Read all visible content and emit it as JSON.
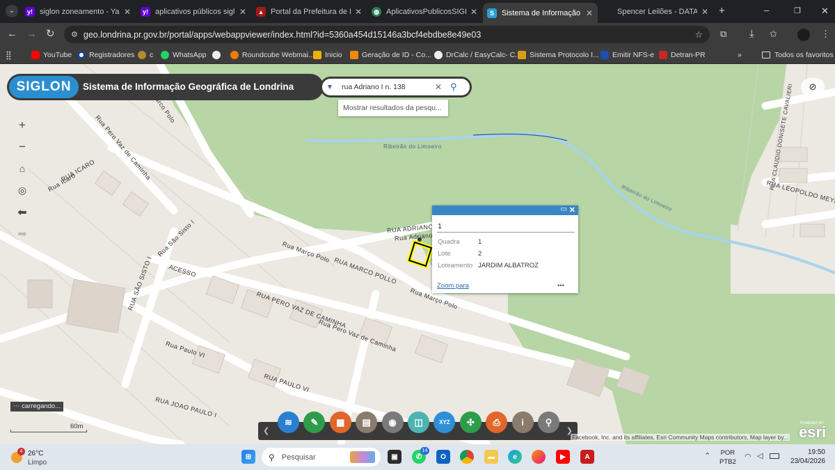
{
  "browser": {
    "tabs": [
      {
        "title": "siglon zoneamento - Yahoo",
        "fav": "yahoo-icon",
        "color": "#6001d2"
      },
      {
        "title": "aplicativos públicos siglon",
        "fav": "yahoo-icon",
        "color": "#6001d2"
      },
      {
        "title": "Portal da Prefeitura de Londrina",
        "fav": "crest-icon",
        "color": "#a11a1a"
      },
      {
        "title": "AplicativosPublicosSIGLON",
        "fav": "globe-icon",
        "color": "#2e7d5b"
      },
      {
        "title": "Sistema de Informação Geográfica",
        "fav": "arcgis-icon",
        "color": "#2a9fd6"
      },
      {
        "title": "Spencer Leilões - DATA DE",
        "fav": "",
        "color": "#3c3c3c"
      }
    ],
    "url": "geo.londrina.pr.gov.br/portal/apps/webappviewer/index.html?id=5360a454d15146a3bcf4ebdbe8e49e03",
    "bookmarks": [
      {
        "label": "YouTube",
        "color": "#ff0000"
      },
      {
        "label": "Registradores",
        "color": "#1c3f8f"
      },
      {
        "label": "c",
        "color": "#b38b2e"
      },
      {
        "label": "WhatsApp",
        "color": "#25d366"
      },
      {
        "label": "Roundcube Webmai...",
        "color": "#f07c00"
      },
      {
        "label": "Inicio",
        "color": "#f0b000"
      },
      {
        "label": "Geração de ID - Co...",
        "color": "#f08a00"
      },
      {
        "label": "DrCalc / EasyCalc- C...",
        "color": "#eeeeee"
      },
      {
        "label": "Sistema Protocolo I...",
        "color": "#d4a017"
      },
      {
        "label": "Emitir NFS-e",
        "color": "#1e4fa8"
      },
      {
        "label": "Detran-PR",
        "color": "#c62828"
      }
    ],
    "all_bookmarks": "Todos os favoritos",
    "more_bookmarks": "»"
  },
  "app": {
    "logo_text": "SIGLON",
    "title": "Sistema de Informação Geográfica de Londrina",
    "search_value": "rua Adriano I n. 138",
    "suggestion": "Mostrar resultados da pesqu..."
  },
  "map": {
    "road_labels": [
      "Ribeirão do Limoeiro",
      "RUA ADRIANO I",
      "Rua Adriano I",
      "Rua Março Polo",
      "RUA MARCO POLLO",
      "RUA PERO VAZ DE CAMINHA",
      "Rua Pero Vaz de Caminha",
      "Rua Paulo VI",
      "RUA PAULO VI",
      "RUA JOAO PAULO I",
      "ACESSO",
      "RUA SÃO SISTO I",
      "Rua São Sisto I",
      "Rua Pero Vaz de Caminha",
      "RUA ICARO",
      "Rua Icaro",
      "Marco Polo",
      "Hélio",
      "RUA CLAUDIO DONISETE CAVALIERI",
      "RUA LEOPOLDO MEYER",
      "Ribeirão do Limoeiro"
    ],
    "scale": "60m",
    "loading": "carregando...",
    "attribution": "Esri Community Maps contributors, Map layer by...",
    "attribution_prefix": "Facebook, Inc. and its affiliates,",
    "esri": "esri",
    "powered": "POWERED BY"
  },
  "popup": {
    "title": "1",
    "fields": [
      {
        "label": "Quadra",
        "value": "1"
      },
      {
        "label": "Lote",
        "value": "2"
      },
      {
        "label": "Loteamento",
        "value": "JARDIM ALBATROZ"
      }
    ],
    "zoom_link": "Zoom para",
    "more": "•••"
  },
  "panel_tools": [
    {
      "name": "layers-button",
      "color": "#2a7fd0",
      "glyph": "≋"
    },
    {
      "name": "measure-button",
      "color": "#2e9d4a",
      "glyph": "✎"
    },
    {
      "name": "basemap-button",
      "color": "#e0662a",
      "glyph": "▦"
    },
    {
      "name": "print-book-button",
      "color": "#8a7b6a",
      "glyph": "▤"
    },
    {
      "name": "locate-button",
      "color": "#7a7a7a",
      "glyph": "◉"
    },
    {
      "name": "compare-button",
      "color": "#4db3b3",
      "glyph": "◫"
    },
    {
      "name": "xyz-button",
      "color": "#2d8fd8",
      "glyph": "XYZ"
    },
    {
      "name": "share-button",
      "color": "#2e9d4a",
      "glyph": "✣"
    },
    {
      "name": "printer-button",
      "color": "#e0662a",
      "glyph": "⎙"
    },
    {
      "name": "info-button",
      "color": "#8a7b6a",
      "glyph": "i"
    },
    {
      "name": "query-button",
      "color": "#7a7a7a",
      "glyph": "⚲"
    }
  ],
  "taskbar": {
    "weather_temp": "26°C",
    "weather_desc": "Limpo",
    "weather_badge": "4",
    "search_placeholder": "Pesquisar",
    "lang_top": "POR",
    "lang_bottom": "PTB2",
    "time": "19:50",
    "date": "23/04/2026",
    "whatsapp_badge": "14"
  }
}
